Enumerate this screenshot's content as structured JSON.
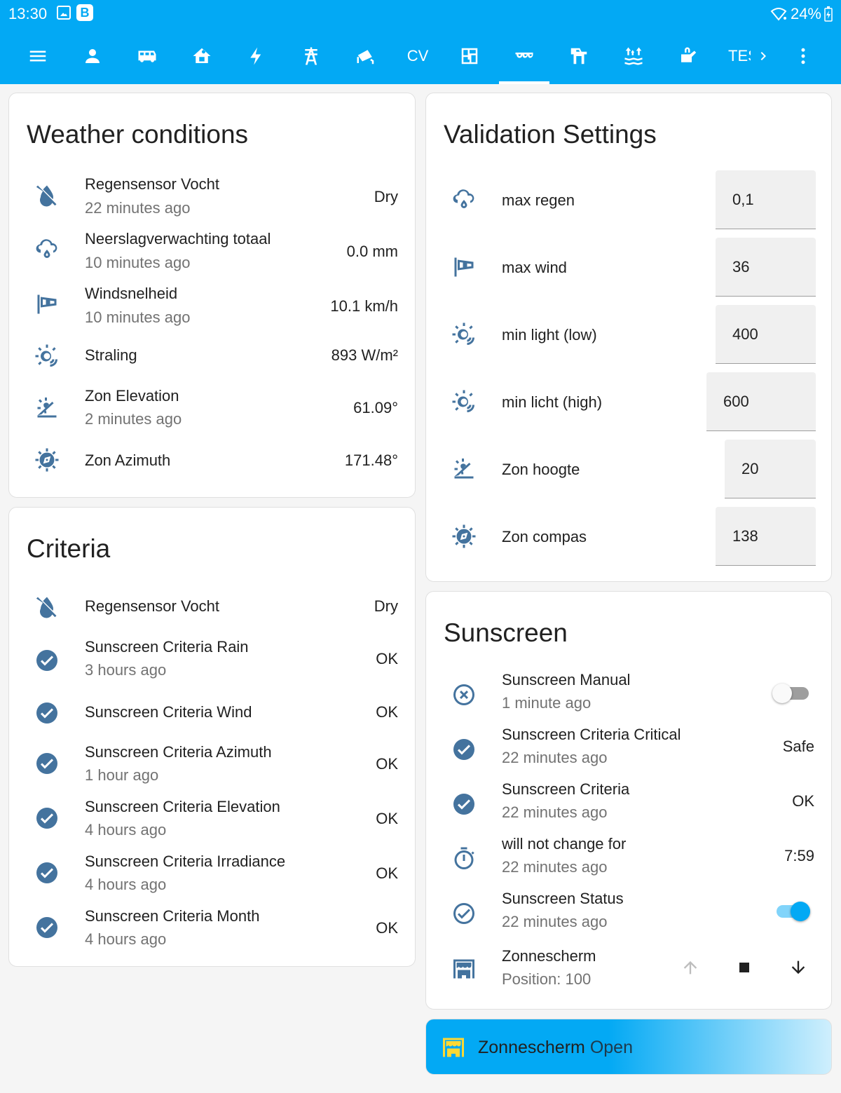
{
  "status_bar": {
    "time": "13:30",
    "b_badge": "B",
    "battery": "24%"
  },
  "toolbar": {
    "icons": [
      "menu-icon",
      "account-icon",
      "bus-icon",
      "home-icon",
      "flash-icon",
      "transmission-tower-icon",
      "cctv-icon"
    ],
    "cv_label": "CV",
    "icons2": [
      "floor-plan-icon",
      "sunscreen-awning-icon",
      "pergola-icon",
      "water-level-icon",
      "watering-can-icon"
    ],
    "tes_label": "TES",
    "more_icon": "dots-vertical-icon",
    "active_tab": "sunscreen-awning-icon"
  },
  "weather": {
    "title": "Weather conditions",
    "rows": [
      {
        "icon": "water-off-icon",
        "name": "Regensensor Vocht",
        "secondary": "22 minutes ago",
        "value": "Dry"
      },
      {
        "icon": "weather-rain-icon",
        "name": "Neerslagverwachting totaal",
        "secondary": "10 minutes ago",
        "value": "0.0 mm"
      },
      {
        "icon": "windsock-icon",
        "name": "Windsnelheid",
        "secondary": "10 minutes ago",
        "value": "10.1 km/h"
      },
      {
        "icon": "sun-wireless-icon",
        "name": "Straling",
        "secondary": "",
        "value": "893 W/m²"
      },
      {
        "icon": "sun-angle-icon",
        "name": "Zon Elevation",
        "secondary": "2 minutes ago",
        "value": "61.09°"
      },
      {
        "icon": "sun-compass-icon",
        "name": "Zon Azimuth",
        "secondary": "",
        "value": "171.48°"
      }
    ]
  },
  "criteria": {
    "title": "Criteria",
    "rows": [
      {
        "icon": "water-off-icon",
        "name": "Regensensor Vocht",
        "secondary": "",
        "value": "Dry"
      },
      {
        "icon": "check-circle-icon",
        "name": "Sunscreen Criteria Rain",
        "secondary": "3 hours ago",
        "value": "OK"
      },
      {
        "icon": "check-circle-icon",
        "name": "Sunscreen Criteria Wind",
        "secondary": "",
        "value": "OK"
      },
      {
        "icon": "check-circle-icon",
        "name": "Sunscreen Criteria Azimuth",
        "secondary": "1 hour ago",
        "value": "OK"
      },
      {
        "icon": "check-circle-icon",
        "name": "Sunscreen Criteria Elevation",
        "secondary": "4 hours ago",
        "value": "OK"
      },
      {
        "icon": "check-circle-icon",
        "name": "Sunscreen Criteria Irradiance",
        "secondary": "4 hours ago",
        "value": "OK"
      },
      {
        "icon": "check-circle-icon",
        "name": "Sunscreen Criteria Month",
        "secondary": "4 hours ago",
        "value": "OK"
      }
    ]
  },
  "validation": {
    "title": "Validation Settings",
    "rows": [
      {
        "icon": "weather-rain-icon",
        "name": "max regen",
        "value": "0,1"
      },
      {
        "icon": "windsock-icon",
        "name": "max wind",
        "value": "36"
      },
      {
        "icon": "sun-wireless-icon",
        "name": "min light (low)",
        "value": "400"
      },
      {
        "icon": "sun-wireless-icon",
        "name": "min licht (high)",
        "value": "600"
      },
      {
        "icon": "sun-angle-icon",
        "name": "Zon hoogte",
        "value": "20"
      },
      {
        "icon": "sun-compass-icon",
        "name": "Zon compas",
        "value": "138"
      }
    ]
  },
  "sunscreen": {
    "title": "Sunscreen",
    "manual": {
      "icon": "close-circle-outline-icon",
      "name": "Sunscreen Manual",
      "secondary": "1 minute ago",
      "state": "off"
    },
    "critical": {
      "icon": "check-circle-icon",
      "name": "Sunscreen Criteria Critical",
      "secondary": "22 minutes ago",
      "value": "Safe"
    },
    "criteria": {
      "icon": "check-circle-icon",
      "name": "Sunscreen Criteria",
      "secondary": "22 minutes ago",
      "value": "OK"
    },
    "timer": {
      "icon": "timer-outline-icon",
      "name": "will not change for",
      "secondary": "22 minutes ago",
      "value": "7:59"
    },
    "status": {
      "icon": "check-circle-outline-icon",
      "name": "Sunscreen Status",
      "secondary": "22 minutes ago",
      "state": "on"
    },
    "cover": {
      "icon": "awning-icon",
      "name": "Zonnescherm",
      "secondary": "Position: 100"
    }
  },
  "banner": {
    "name": "Zonnescherm",
    "state": "Open"
  },
  "colors": {
    "header": "#03a9f4",
    "icon": "#44739e",
    "toggle_on": "#03a9f4",
    "banner_icon": "#fdd835"
  }
}
